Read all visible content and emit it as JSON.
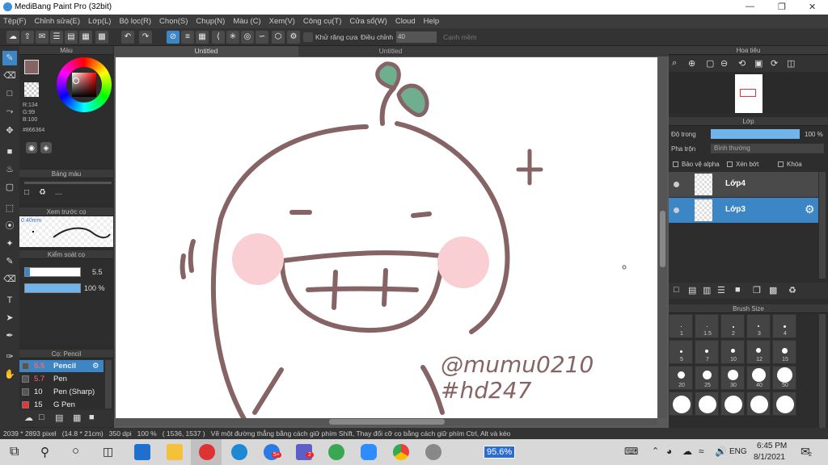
{
  "window": {
    "title": "MediBang Paint Pro (32bit)"
  },
  "menu": [
    "Tệp(F)",
    "Chỉnh sửa(E)",
    "Lớp(L)",
    "Bộ lọc(R)",
    "Chọn(S)",
    "Chụp(N)",
    "Màu (C)",
    "Xem(V)",
    "Công cụ(T)",
    "Cửa sổ(W)",
    "Cloud",
    "Help"
  ],
  "toolbar": {
    "antialias_label": "Khử răng cưa",
    "correction_label": "Điều chỉnh",
    "correction_value": "40",
    "snap_label": "Cạnh mềm"
  },
  "color_panel": {
    "title": "Màu",
    "r": "R:134",
    "g": "G:99",
    "b": "B:100",
    "hex": "#866364",
    "current_color": "#866364"
  },
  "palette_panel": {
    "title": "Bảng màu",
    "placeholder": "---"
  },
  "preview_panel": {
    "title": "Xem trước cọ",
    "size": "0.40mm"
  },
  "brush_control": {
    "title": "Kiểm soát cọ",
    "size": "5.5",
    "opacity": "100 %"
  },
  "brush_panel": {
    "title": "Cọ: Pencil",
    "items": [
      {
        "size": "5.5",
        "name": "Pencil",
        "color": "#f26a6a"
      },
      {
        "size": "5.7",
        "name": "Pen",
        "color": "#f26a6a"
      },
      {
        "size": "10",
        "name": "Pen (Sharp)",
        "color": "#eeeeee"
      },
      {
        "size": "15",
        "name": "G Pen",
        "color": "#eeeeee"
      }
    ]
  },
  "tabs": [
    "Untitled",
    "Untitled"
  ],
  "canvas": {
    "text1": "@mumu0210",
    "text2": "#hd247",
    "stroke_color": "#866364",
    "blush_color": "#f9cfd3",
    "leaf_color": "#6fae8e"
  },
  "navigator": {
    "title": "Hoa tiêu"
  },
  "layer_panel": {
    "title": "Lớp",
    "opacity_label": "Độ trong",
    "opacity_value": "100 %",
    "blend_label": "Pha trộn",
    "blend_value": "Bình thường",
    "protect_alpha": "Bảo vệ alpha",
    "clipping": "Xén bớt",
    "lock": "Khóa",
    "layers": [
      {
        "name": "Lớp4",
        "selected": false
      },
      {
        "name": "Lớp3",
        "selected": true
      }
    ]
  },
  "brush_size": {
    "title": "Brush Size",
    "labels": [
      "1",
      "1.5",
      "2",
      "3",
      "4",
      "5",
      "7",
      "10",
      "12",
      "15",
      "20",
      "25",
      "30",
      "40",
      "50"
    ]
  },
  "status": {
    "dims": "2039 * 2893 pixel",
    "cm": "(14.8 * 21cm)",
    "dpi": "350 dpi",
    "zoom": "100 %",
    "coords": "( 1536, 1537 )",
    "hint": "Vẽ một đường thẳng bằng cách giữ phím Shift, Thay đổi cỡ cọ bằng cách giữ phím Ctrl, Alt và kéo"
  },
  "taskbar": {
    "zoom_badge": "95.6%",
    "lang": "ENG",
    "time": "6:45 PM",
    "date": "8/1/2021",
    "notif_count": "2",
    "zalo_badge": "5+",
    "teams_badge": "2"
  }
}
